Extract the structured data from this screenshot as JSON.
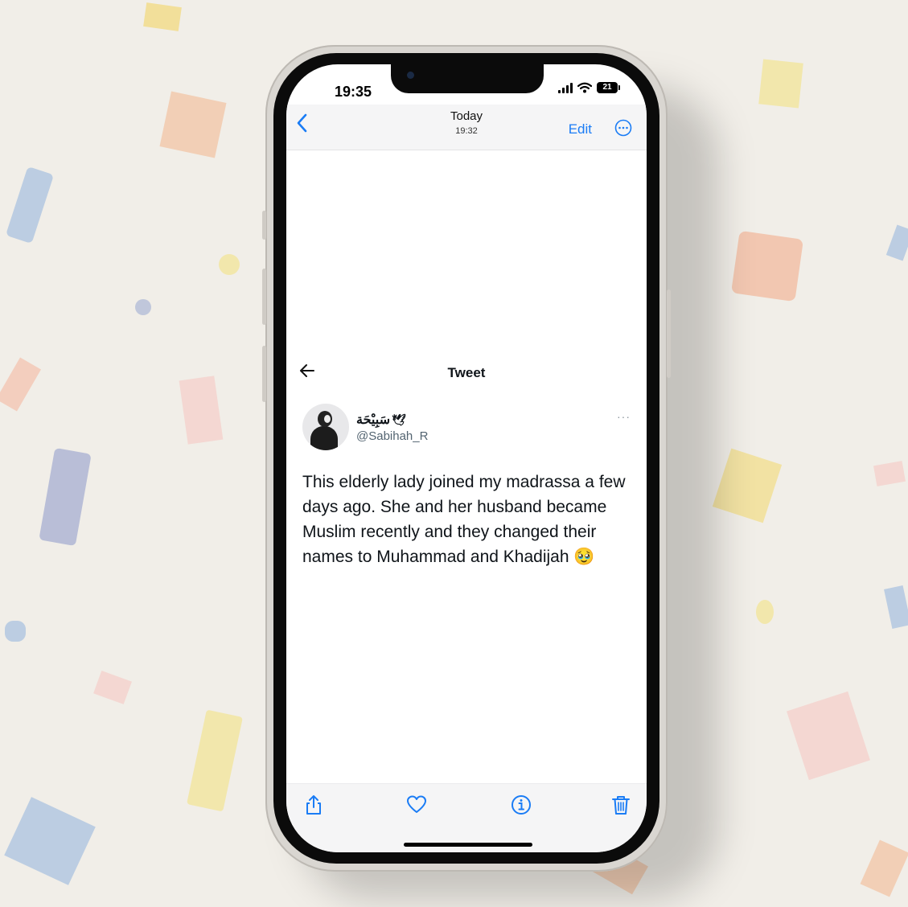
{
  "colors": {
    "ios_blue": "#1a7cf5",
    "background": "#f1eee8",
    "text": "#0f1419",
    "muted": "#536471"
  },
  "status_bar": {
    "time": "19:35",
    "battery": "21",
    "icons": [
      "signal-icon",
      "wifi-icon",
      "battery-icon"
    ]
  },
  "nav": {
    "back_icon": "chevron-left-icon",
    "title": "Today",
    "subtitle": "19:32",
    "edit_label": "Edit",
    "more_icon": "more-circle-icon"
  },
  "tweet": {
    "header_title": "Tweet",
    "back_icon": "arrow-left-icon",
    "display_name": "سَبِيْحَة",
    "name_emoji": "🕊",
    "handle": "@Sabihah_R",
    "more": "···",
    "text": "This elderly lady joined my madrassa a few days ago. She and her husband became Muslim recently and they changed their names to Muhammad and Khadijah 🥹"
  },
  "toolbar": {
    "icons": [
      "share-icon",
      "heart-icon",
      "info-icon",
      "trash-icon"
    ]
  }
}
